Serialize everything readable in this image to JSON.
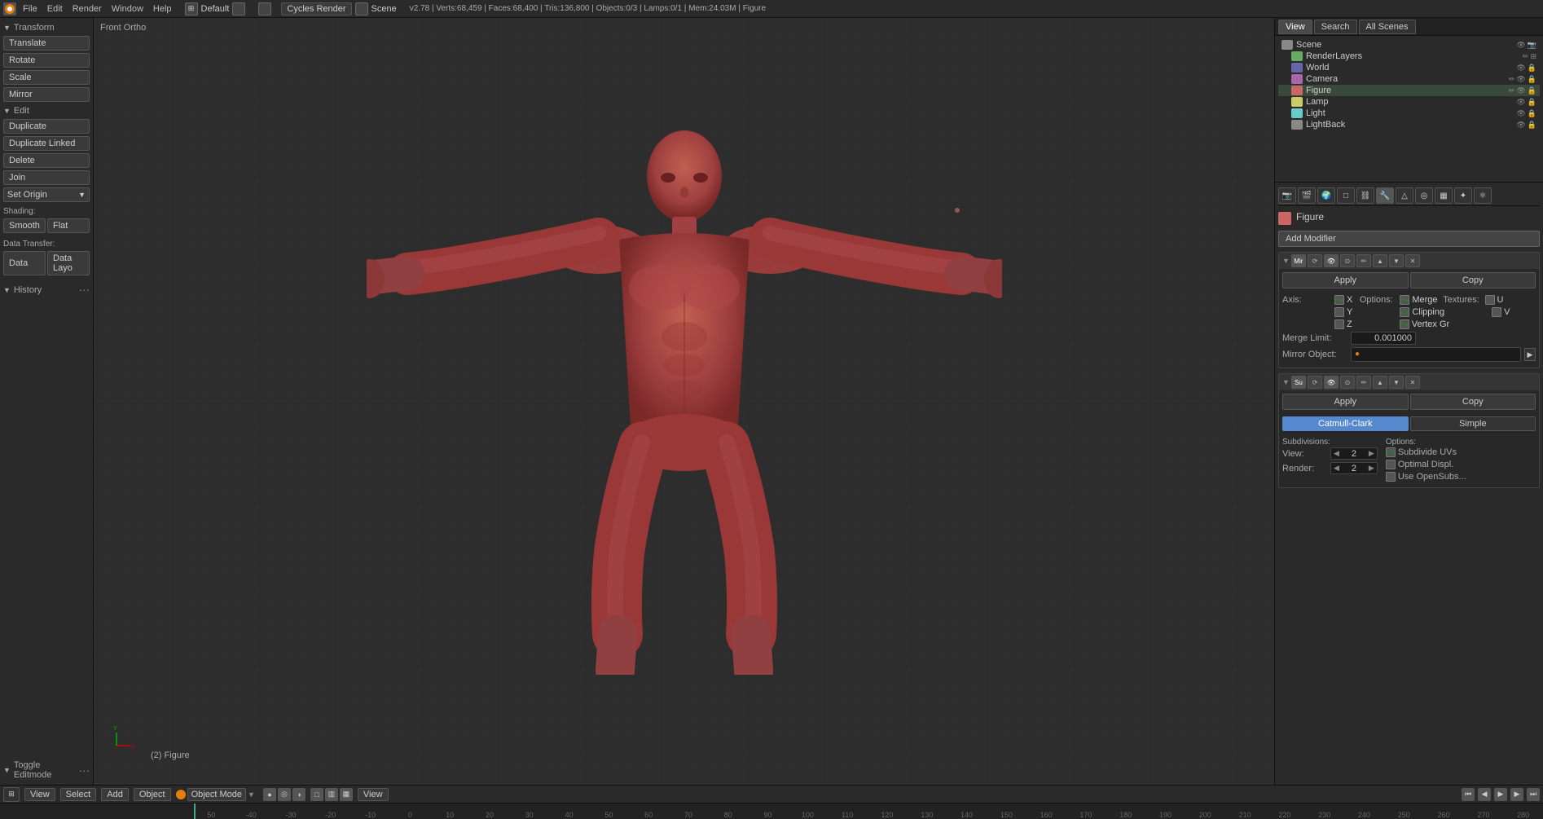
{
  "topbar": {
    "icon": "blender-icon",
    "menus": [
      "File",
      "Edit",
      "Render",
      "Window",
      "Help"
    ],
    "engine_label": "Cycles Render",
    "scene_label": "Scene",
    "info": "v2.78 | Verts:68,459 | Faces:68,400 | Tris:136,800 | Objects:0/3 | Lamps:0/1 | Mem:24.03M | Figure",
    "workspace": "Default"
  },
  "outliner": {
    "header_left": "View",
    "header_middle": "Search",
    "header_right": "All Scenes",
    "items": [
      {
        "name": "Scene",
        "type": "scene",
        "indent": 0
      },
      {
        "name": "RenderLayers",
        "type": "layer",
        "indent": 1
      },
      {
        "name": "World",
        "type": "world",
        "indent": 1
      },
      {
        "name": "Camera",
        "type": "camera",
        "indent": 1
      },
      {
        "name": "Figure",
        "type": "mesh",
        "indent": 1
      },
      {
        "name": "Lamp",
        "type": "lamp",
        "indent": 1
      },
      {
        "name": "Light",
        "type": "light",
        "indent": 1
      },
      {
        "name": "LightBack",
        "type": "back",
        "indent": 1
      }
    ]
  },
  "properties": {
    "figure_label": "Figure",
    "add_modifier_label": "Add Modifier",
    "modifier1": {
      "name": "Mir",
      "apply_label": "Apply",
      "copy_label": "Copy",
      "axis_label": "Axis:",
      "options_label": "Options:",
      "textures_label": "Textures:",
      "x_checked": true,
      "y_checked": false,
      "z_checked": false,
      "merge_checked": true,
      "clipping_checked": true,
      "vertex_gr_checked": true,
      "u_checked": false,
      "v_checked": false,
      "merge_limit_label": "Merge Limit:",
      "merge_limit_value": "0.001000",
      "mirror_object_label": "Mirror Object:"
    },
    "modifier2": {
      "name": "Su",
      "apply_label": "Apply",
      "copy_label": "Copy",
      "tab1_label": "Catmull-Clark",
      "tab2_label": "Simple",
      "subdivisions_label": "Subdivisions:",
      "view_label": "View:",
      "view_value": "2",
      "render_label": "Render:",
      "render_value": "2",
      "options_label": "Options:",
      "subdivide_uvs_checked": true,
      "subdivide_uvs_label": "Subdivide UVs",
      "optimal_displ_checked": false,
      "optimal_displ_label": "Optimal Displ.",
      "use_opensubdiv_checked": false,
      "use_opensubdiv_label": "Use OpenSubs..."
    }
  },
  "left_panel": {
    "transform_label": "Transform",
    "translate_label": "Translate",
    "rotate_label": "Rotate",
    "scale_label": "Scale",
    "mirror_label": "Mirror",
    "edit_label": "Edit",
    "duplicate_label": "Duplicate",
    "duplicate_linked_label": "Duplicate Linked",
    "delete_label": "Delete",
    "join_label": "Join",
    "set_origin_label": "Set Origin",
    "shading_label": "Shading:",
    "smooth_label": "Smooth",
    "flat_label": "Flat",
    "data_transfer_label": "Data Transfer:",
    "data_label": "Data",
    "data_layo_label": "Data Layo",
    "history_label": "History",
    "smooth_flat_label": "Smooth Flat",
    "toggle_editmode_label": "Toggle Editmode"
  },
  "viewport": {
    "view_label": "Front Ortho",
    "object_label": "(2) Figure"
  },
  "bottom_toolbar": {
    "view_label": "View",
    "select_label": "Select",
    "add_label": "Add",
    "object_label": "Object",
    "mode_label": "Object Mode",
    "view_btn_label": "View"
  },
  "timeline": {
    "marks": [
      "50",
      "-40",
      "-30",
      "-20",
      "-10",
      "0",
      "10",
      "20",
      "30",
      "40",
      "50",
      "60",
      "70",
      "80",
      "90",
      "100",
      "110",
      "120",
      "130",
      "140",
      "150",
      "160",
      "170",
      "180",
      "190",
      "200",
      "210",
      "220",
      "230",
      "240",
      "250",
      "260",
      "270",
      "280"
    ]
  }
}
